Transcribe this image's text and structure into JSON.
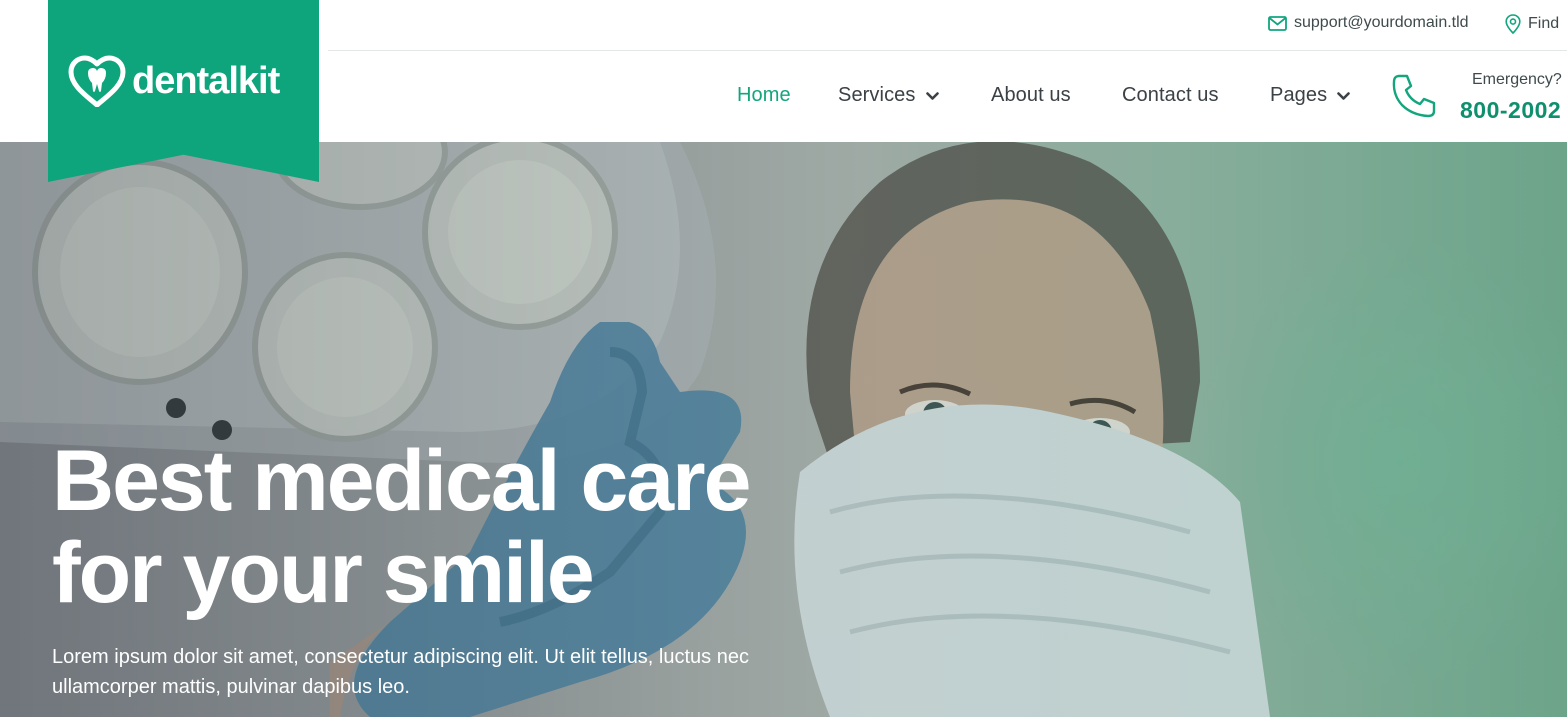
{
  "topbar": {
    "email": "support@yourdomain.tld",
    "find": "Find"
  },
  "logo": {
    "text": "dentalkit"
  },
  "nav": {
    "items": [
      {
        "label": "Home",
        "active": true
      },
      {
        "label": "Services",
        "dropdown": true
      },
      {
        "label": "About us"
      },
      {
        "label": "Contact us"
      },
      {
        "label": "Pages",
        "dropdown": true
      }
    ]
  },
  "emergency": {
    "label": "Emergency?",
    "number": "800-2002"
  },
  "hero": {
    "title_line1": "Best medical care",
    "title_line2": "for your smile",
    "text_line1": "Lorem ipsum dolor sit amet, consectetur adipiscing elit. Ut elit tellus, luctus nec",
    "text_line2": "ullamcorper mattis, pulvinar dapibus leo."
  },
  "colors": {
    "brand": "#0fa57c",
    "nav_active": "#12a57e",
    "emergency_number": "#0f8f6d",
    "nav_text": "#3b4145"
  },
  "icons": {
    "email": "envelope-icon",
    "find": "map-pin-icon",
    "phone": "phone-icon",
    "dropdown": "chevron-down-icon",
    "logo": "tooth-heart-icon"
  }
}
